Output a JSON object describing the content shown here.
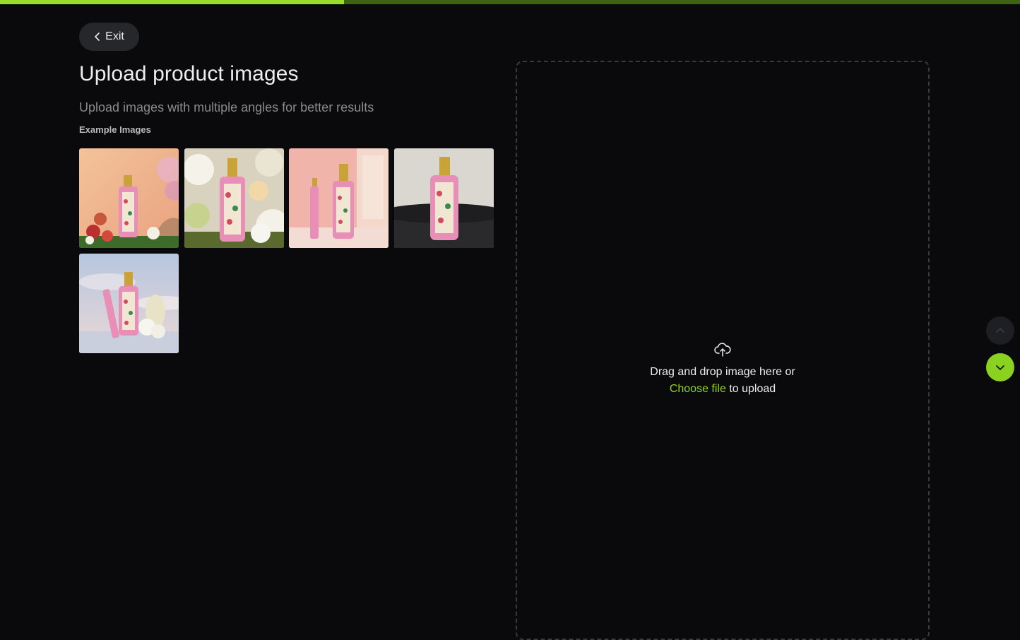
{
  "progress": {
    "fraction": 0.337,
    "fill_color": "#9bdc28",
    "track_color": "#3d6310"
  },
  "header": {
    "exit_label": "Exit",
    "exit_icon": "chevron-left-icon"
  },
  "main": {
    "title": "Upload product images",
    "subtitle": "Upload images with multiple angles for better results",
    "examples_label": "Example Images",
    "example_images": [
      {
        "name": "example-image-1",
        "scene": "peach"
      },
      {
        "name": "example-image-2",
        "scene": "floral"
      },
      {
        "name": "example-image-3",
        "scene": "pink-room"
      },
      {
        "name": "example-image-4",
        "scene": "dark-table"
      },
      {
        "name": "example-image-5",
        "scene": "sky"
      }
    ]
  },
  "dropzone": {
    "icon": "cloud-upload-icon",
    "text_line1": "Drag and drop image here or",
    "choose_file": "Choose file",
    "text_line2_suffix": " to upload"
  },
  "side_nav": {
    "up_icon": "chevron-up-icon",
    "down_icon": "chevron-down-icon"
  },
  "colors": {
    "accent": "#8bd11f",
    "background": "#0a0a0c"
  }
}
